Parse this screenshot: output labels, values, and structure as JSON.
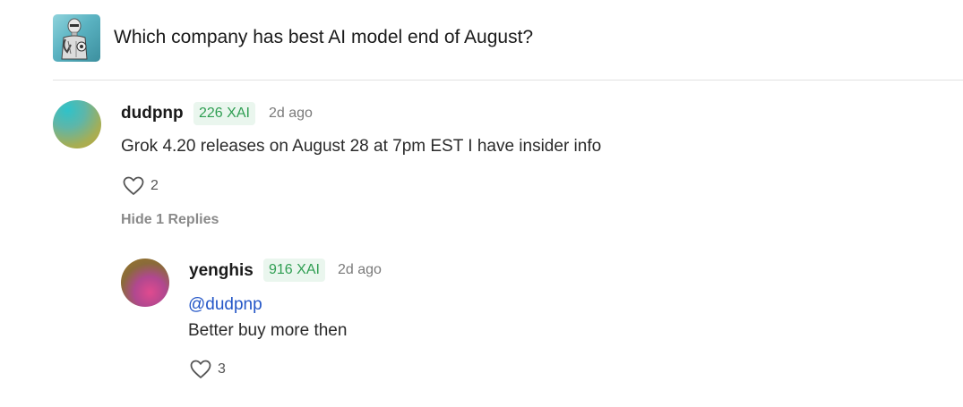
{
  "market": {
    "title": "Which company has best AI model end of August?"
  },
  "comments": [
    {
      "username": "dudpnp",
      "badge": "226 XAI",
      "timestamp": "2d ago",
      "text": "Grok 4.20 releases on August 28 at 7pm EST I have insider info",
      "likes": "2",
      "replies_toggle": "Hide 1 Replies",
      "replies": [
        {
          "username": "yenghis",
          "badge": "916 XAI",
          "timestamp": "2d ago",
          "mention": "@dudpnp",
          "text": "Better buy more then",
          "likes": "3"
        }
      ]
    }
  ],
  "colors": {
    "badge_text": "#2f9e52",
    "badge_bg": "#eaf6ee",
    "mention": "#2456c7"
  },
  "icons": {
    "market": "robot-thumbnail",
    "like": "heart-icon"
  }
}
